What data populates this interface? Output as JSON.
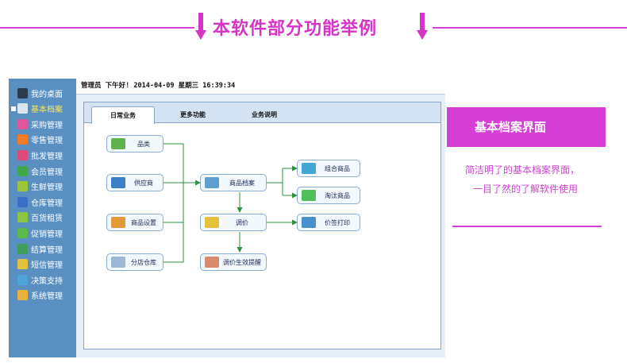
{
  "banner": {
    "title": "本软件部分功能举例"
  },
  "sidebar": {
    "items": [
      {
        "label": "我的桌面",
        "icon": "monitor-icon",
        "color": "#2b3b4f",
        "active": false
      },
      {
        "label": "基本档案",
        "icon": "archive-icon",
        "color": "#d9e6f2",
        "active": true
      },
      {
        "label": "采购管理",
        "icon": "purchase-icon",
        "color": "#e0559b",
        "active": false
      },
      {
        "label": "零售管理",
        "icon": "retail-icon",
        "color": "#f07a25",
        "active": false
      },
      {
        "label": "批发管理",
        "icon": "wholesale-icon",
        "color": "#e04a7a",
        "active": false
      },
      {
        "label": "会员管理",
        "icon": "members-icon",
        "color": "#3ea84a",
        "active": false
      },
      {
        "label": "生鲜管理",
        "icon": "fresh-icon",
        "color": "#9cc63a",
        "active": false
      },
      {
        "label": "仓库管理",
        "icon": "warehouse-icon",
        "color": "#3a6fc7",
        "active": false
      },
      {
        "label": "百货租赁",
        "icon": "lease-icon",
        "color": "#8cc63f",
        "active": false
      },
      {
        "label": "促销管理",
        "icon": "promotion-icon",
        "color": "#5bb84b",
        "active": false
      },
      {
        "label": "结算管理",
        "icon": "settlement-icon",
        "color": "#3f9e5c",
        "active": false
      },
      {
        "label": "短信管理",
        "icon": "sms-icon",
        "color": "#e2c23a",
        "active": false
      },
      {
        "label": "决策支持",
        "icon": "decision-icon",
        "color": "#4fa3d9",
        "active": false
      },
      {
        "label": "系统管理",
        "icon": "system-icon",
        "color": "#e8b23a",
        "active": false
      }
    ]
  },
  "topbar": {
    "status": "管理员 下午好! 2014-04-09 星期三 16:39:34"
  },
  "tabs": [
    {
      "label": "日常业务",
      "active": true
    },
    {
      "label": "更多功能",
      "active": false
    },
    {
      "label": "业务说明",
      "active": false
    }
  ],
  "nodes": {
    "category": {
      "label": "品类",
      "icon": "category-icon",
      "color": "#5fb34a"
    },
    "supplier": {
      "label": "供应商",
      "icon": "supplier-icon",
      "color": "#3b7fc9"
    },
    "product_settings": {
      "label": "商品设置",
      "icon": "product-settings-icon",
      "color": "#e49a3a"
    },
    "branch_warehouse": {
      "label": "分店仓库",
      "icon": "branch-warehouse-icon",
      "color": "#9db7d4"
    },
    "product_archive": {
      "label": "商品档案",
      "icon": "product-archive-icon",
      "color": "#5f9fd0"
    },
    "price_adjust": {
      "label": "调价",
      "icon": "price-adjust-icon",
      "color": "#e2c23a"
    },
    "price_effect_reminder": {
      "label": "调价生效提醒",
      "icon": "reminder-icon",
      "color": "#d98a6a"
    },
    "combo_product": {
      "label": "组合商品",
      "icon": "combo-product-icon",
      "color": "#3fa6d6"
    },
    "obsolete_product": {
      "label": "淘汰商品",
      "icon": "obsolete-product-icon",
      "color": "#4fbf5a"
    },
    "price_tag_print": {
      "label": "价签打印",
      "icon": "price-tag-icon",
      "color": "#4a8fd0"
    }
  },
  "flow_color": "#2f8f3e",
  "callout": {
    "title": "基本档案界面",
    "line1": "简洁明了的基本档案界面，",
    "line2": "一目了然的了解软件使用",
    "color": "#d63fd6"
  }
}
